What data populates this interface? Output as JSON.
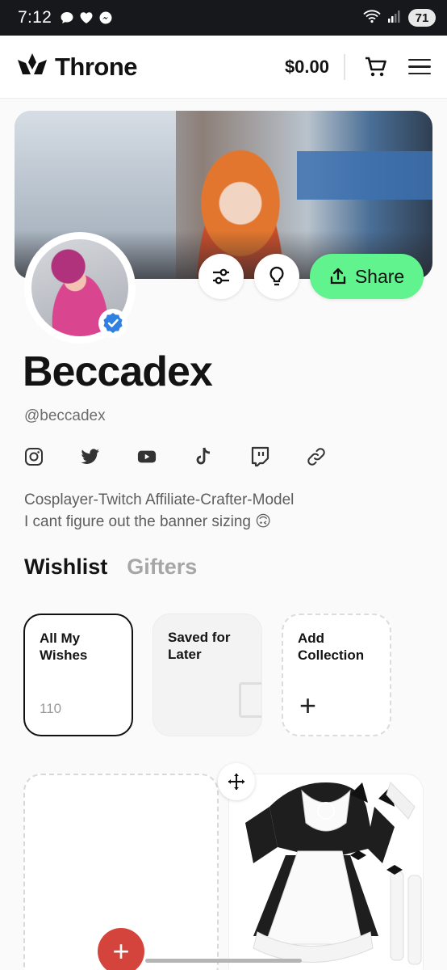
{
  "status_bar": {
    "time": "7:12",
    "battery": "71"
  },
  "header": {
    "brand": "Throne",
    "balance": "$0.00",
    "icons": [
      "throne-logo-icon",
      "cart-icon",
      "menu-icon"
    ]
  },
  "profile": {
    "display_name": "Beccadex",
    "handle": "@beccadex",
    "bio_line1": "Cosplayer-Twitch Affiliate-Crafter-Model",
    "bio_line2": "I cant figure out the banner sizing 🙃",
    "share_label": "Share",
    "socials": [
      "instagram-icon",
      "twitter-icon",
      "youtube-icon",
      "tiktok-icon",
      "twitch-icon",
      "link-icon"
    ]
  },
  "tabs": [
    {
      "label": "Wishlist",
      "active": true
    },
    {
      "label": "Gifters",
      "active": false
    }
  ],
  "collections": [
    {
      "title_line1": "All My",
      "title_line2": "Wishes",
      "count": "110"
    },
    {
      "title_line1": "Saved for",
      "title_line2": "Later"
    },
    {
      "title_line1": "Add",
      "title_line2": "Collection",
      "plus": "+"
    }
  ],
  "fab": {
    "label": "+"
  },
  "colors": {
    "accent_green": "#61f38d",
    "fab_red": "#d5443c",
    "verified_blue": "#2f80e0"
  }
}
